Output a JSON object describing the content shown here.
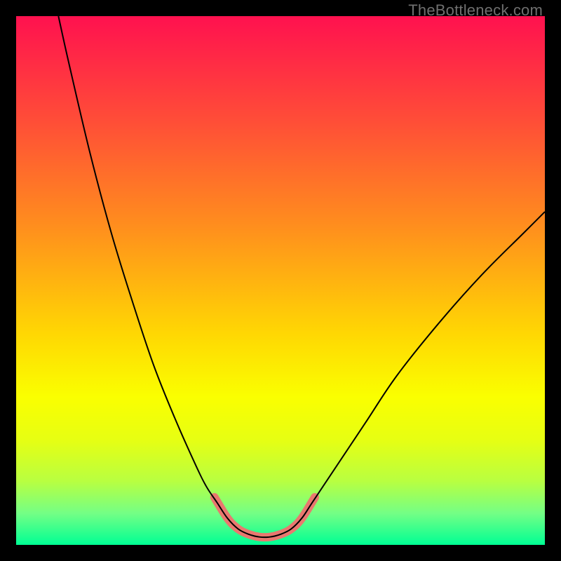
{
  "watermark": "TheBottleneck.com",
  "chart_data": {
    "type": "line",
    "title": "",
    "xlabel": "",
    "ylabel": "",
    "xlim": [
      0,
      100
    ],
    "ylim": [
      0,
      100
    ],
    "background_gradient_stops": [
      {
        "offset": 0.0,
        "color": "#ff114f"
      },
      {
        "offset": 0.2,
        "color": "#ff4e37"
      },
      {
        "offset": 0.4,
        "color": "#ff8f1d"
      },
      {
        "offset": 0.6,
        "color": "#ffd703"
      },
      {
        "offset": 0.72,
        "color": "#faff00"
      },
      {
        "offset": 0.8,
        "color": "#e7ff12"
      },
      {
        "offset": 0.88,
        "color": "#b8ff41"
      },
      {
        "offset": 0.94,
        "color": "#74ff85"
      },
      {
        "offset": 1.0,
        "color": "#00ff94"
      }
    ],
    "series": [
      {
        "name": "bottleneck-curve",
        "stroke": "#000000",
        "stroke_width": 2,
        "points": [
          {
            "x": 8.0,
            "y": 100.0
          },
          {
            "x": 10.0,
            "y": 91.0
          },
          {
            "x": 14.0,
            "y": 74.0
          },
          {
            "x": 18.0,
            "y": 59.0
          },
          {
            "x": 22.0,
            "y": 46.0
          },
          {
            "x": 26.0,
            "y": 34.0
          },
          {
            "x": 30.0,
            "y": 24.0
          },
          {
            "x": 34.0,
            "y": 15.0
          },
          {
            "x": 36.0,
            "y": 11.0
          },
          {
            "x": 38.0,
            "y": 8.0
          },
          {
            "x": 40.0,
            "y": 5.0
          },
          {
            "x": 42.0,
            "y": 3.0
          },
          {
            "x": 44.0,
            "y": 2.0
          },
          {
            "x": 46.0,
            "y": 1.5
          },
          {
            "x": 48.0,
            "y": 1.5
          },
          {
            "x": 50.0,
            "y": 2.0
          },
          {
            "x": 52.0,
            "y": 3.0
          },
          {
            "x": 54.0,
            "y": 5.0
          },
          {
            "x": 56.0,
            "y": 8.0
          },
          {
            "x": 60.0,
            "y": 14.0
          },
          {
            "x": 66.0,
            "y": 23.0
          },
          {
            "x": 72.0,
            "y": 32.0
          },
          {
            "x": 80.0,
            "y": 42.0
          },
          {
            "x": 88.0,
            "y": 51.0
          },
          {
            "x": 96.0,
            "y": 59.0
          },
          {
            "x": 100.0,
            "y": 63.0
          }
        ]
      },
      {
        "name": "valley-highlight",
        "stroke": "#e9776f",
        "stroke_width": 12,
        "linecap": "round",
        "points": [
          {
            "x": 37.5,
            "y": 9.0
          },
          {
            "x": 40.0,
            "y": 5.0
          },
          {
            "x": 42.0,
            "y": 3.0
          },
          {
            "x": 44.0,
            "y": 2.0
          },
          {
            "x": 46.0,
            "y": 1.5
          },
          {
            "x": 48.0,
            "y": 1.5
          },
          {
            "x": 50.0,
            "y": 2.0
          },
          {
            "x": 52.0,
            "y": 3.0
          },
          {
            "x": 54.0,
            "y": 5.0
          },
          {
            "x": 56.5,
            "y": 9.0
          }
        ]
      }
    ]
  }
}
